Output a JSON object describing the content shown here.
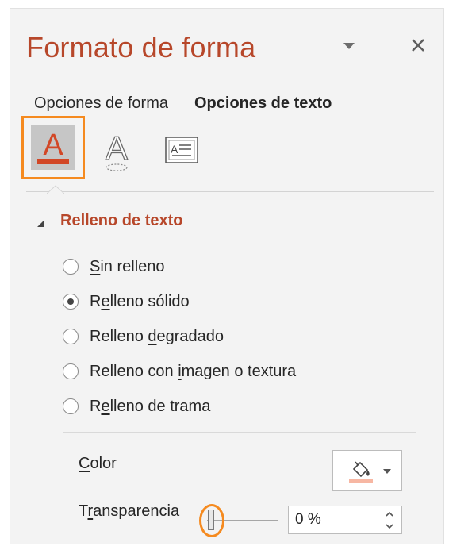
{
  "pane": {
    "title": "Formato de forma",
    "menu_icon": "triangle-down-icon",
    "close_icon": "close-icon"
  },
  "tabs": [
    {
      "label": "Opciones de forma",
      "active": false
    },
    {
      "label": "Opciones de texto",
      "active": true
    }
  ],
  "icon_tabs": [
    {
      "name": "text-fill-outline-icon",
      "selected": true
    },
    {
      "name": "text-effects-icon",
      "selected": false
    },
    {
      "name": "text-box-icon",
      "selected": false
    }
  ],
  "section": {
    "title": "Relleno de texto",
    "expanded": true,
    "options": [
      {
        "pre": "",
        "accel": "S",
        "post": "in relleno",
        "checked": false
      },
      {
        "pre": "R",
        "accel": "e",
        "post": "lleno sólido",
        "checked": true
      },
      {
        "pre": "Relleno ",
        "accel": "d",
        "post": "egradado",
        "checked": false
      },
      {
        "pre": "Relleno con ",
        "accel": "i",
        "post": "magen o textura",
        "checked": false
      },
      {
        "pre": "R",
        "accel": "e",
        "post": "lleno de trama",
        "checked": false
      }
    ]
  },
  "color": {
    "label_accel": "C",
    "label_rest": "olor",
    "swatch": "#f7b7a3",
    "icon": "paint-bucket-icon"
  },
  "transparency": {
    "label_pre": "T",
    "label_accel": "r",
    "label_post": "ansparencia",
    "value": "0 %",
    "percent": 0
  },
  "colors": {
    "accent": "#b7472a",
    "highlight": "#f58a1f",
    "fill_bar": "#d24726"
  }
}
